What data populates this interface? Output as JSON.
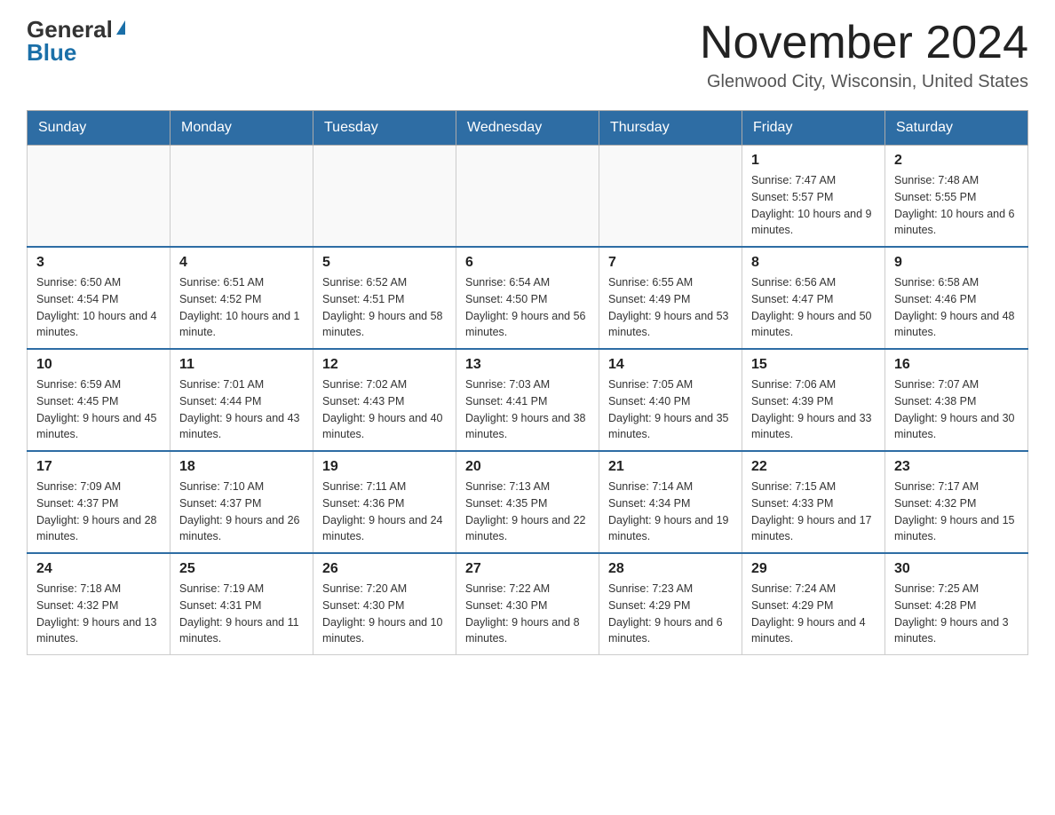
{
  "logo": {
    "general": "General",
    "blue": "Blue"
  },
  "title": "November 2024",
  "subtitle": "Glenwood City, Wisconsin, United States",
  "weekdays": [
    "Sunday",
    "Monday",
    "Tuesday",
    "Wednesday",
    "Thursday",
    "Friday",
    "Saturday"
  ],
  "weeks": [
    [
      {
        "day": "",
        "info": ""
      },
      {
        "day": "",
        "info": ""
      },
      {
        "day": "",
        "info": ""
      },
      {
        "day": "",
        "info": ""
      },
      {
        "day": "",
        "info": ""
      },
      {
        "day": "1",
        "info": "Sunrise: 7:47 AM\nSunset: 5:57 PM\nDaylight: 10 hours and 9 minutes."
      },
      {
        "day": "2",
        "info": "Sunrise: 7:48 AM\nSunset: 5:55 PM\nDaylight: 10 hours and 6 minutes."
      }
    ],
    [
      {
        "day": "3",
        "info": "Sunrise: 6:50 AM\nSunset: 4:54 PM\nDaylight: 10 hours and 4 minutes."
      },
      {
        "day": "4",
        "info": "Sunrise: 6:51 AM\nSunset: 4:52 PM\nDaylight: 10 hours and 1 minute."
      },
      {
        "day": "5",
        "info": "Sunrise: 6:52 AM\nSunset: 4:51 PM\nDaylight: 9 hours and 58 minutes."
      },
      {
        "day": "6",
        "info": "Sunrise: 6:54 AM\nSunset: 4:50 PM\nDaylight: 9 hours and 56 minutes."
      },
      {
        "day": "7",
        "info": "Sunrise: 6:55 AM\nSunset: 4:49 PM\nDaylight: 9 hours and 53 minutes."
      },
      {
        "day": "8",
        "info": "Sunrise: 6:56 AM\nSunset: 4:47 PM\nDaylight: 9 hours and 50 minutes."
      },
      {
        "day": "9",
        "info": "Sunrise: 6:58 AM\nSunset: 4:46 PM\nDaylight: 9 hours and 48 minutes."
      }
    ],
    [
      {
        "day": "10",
        "info": "Sunrise: 6:59 AM\nSunset: 4:45 PM\nDaylight: 9 hours and 45 minutes."
      },
      {
        "day": "11",
        "info": "Sunrise: 7:01 AM\nSunset: 4:44 PM\nDaylight: 9 hours and 43 minutes."
      },
      {
        "day": "12",
        "info": "Sunrise: 7:02 AM\nSunset: 4:43 PM\nDaylight: 9 hours and 40 minutes."
      },
      {
        "day": "13",
        "info": "Sunrise: 7:03 AM\nSunset: 4:41 PM\nDaylight: 9 hours and 38 minutes."
      },
      {
        "day": "14",
        "info": "Sunrise: 7:05 AM\nSunset: 4:40 PM\nDaylight: 9 hours and 35 minutes."
      },
      {
        "day": "15",
        "info": "Sunrise: 7:06 AM\nSunset: 4:39 PM\nDaylight: 9 hours and 33 minutes."
      },
      {
        "day": "16",
        "info": "Sunrise: 7:07 AM\nSunset: 4:38 PM\nDaylight: 9 hours and 30 minutes."
      }
    ],
    [
      {
        "day": "17",
        "info": "Sunrise: 7:09 AM\nSunset: 4:37 PM\nDaylight: 9 hours and 28 minutes."
      },
      {
        "day": "18",
        "info": "Sunrise: 7:10 AM\nSunset: 4:37 PM\nDaylight: 9 hours and 26 minutes."
      },
      {
        "day": "19",
        "info": "Sunrise: 7:11 AM\nSunset: 4:36 PM\nDaylight: 9 hours and 24 minutes."
      },
      {
        "day": "20",
        "info": "Sunrise: 7:13 AM\nSunset: 4:35 PM\nDaylight: 9 hours and 22 minutes."
      },
      {
        "day": "21",
        "info": "Sunrise: 7:14 AM\nSunset: 4:34 PM\nDaylight: 9 hours and 19 minutes."
      },
      {
        "day": "22",
        "info": "Sunrise: 7:15 AM\nSunset: 4:33 PM\nDaylight: 9 hours and 17 minutes."
      },
      {
        "day": "23",
        "info": "Sunrise: 7:17 AM\nSunset: 4:32 PM\nDaylight: 9 hours and 15 minutes."
      }
    ],
    [
      {
        "day": "24",
        "info": "Sunrise: 7:18 AM\nSunset: 4:32 PM\nDaylight: 9 hours and 13 minutes."
      },
      {
        "day": "25",
        "info": "Sunrise: 7:19 AM\nSunset: 4:31 PM\nDaylight: 9 hours and 11 minutes."
      },
      {
        "day": "26",
        "info": "Sunrise: 7:20 AM\nSunset: 4:30 PM\nDaylight: 9 hours and 10 minutes."
      },
      {
        "day": "27",
        "info": "Sunrise: 7:22 AM\nSunset: 4:30 PM\nDaylight: 9 hours and 8 minutes."
      },
      {
        "day": "28",
        "info": "Sunrise: 7:23 AM\nSunset: 4:29 PM\nDaylight: 9 hours and 6 minutes."
      },
      {
        "day": "29",
        "info": "Sunrise: 7:24 AM\nSunset: 4:29 PM\nDaylight: 9 hours and 4 minutes."
      },
      {
        "day": "30",
        "info": "Sunrise: 7:25 AM\nSunset: 4:28 PM\nDaylight: 9 hours and 3 minutes."
      }
    ]
  ]
}
